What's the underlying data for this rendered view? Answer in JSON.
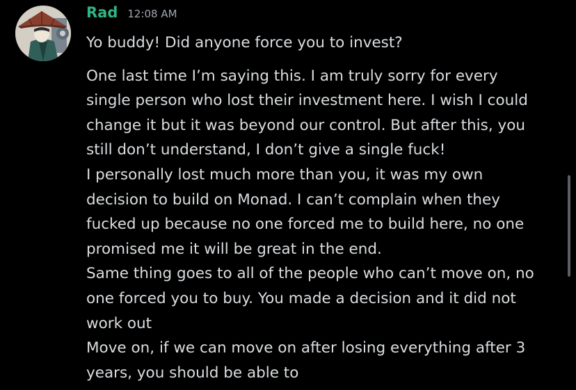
{
  "message": {
    "username": "Rad",
    "username_color": "#2fb584",
    "timestamp": "12:08 AM",
    "avatar": "avatar-icon",
    "lines": [
      "Yo buddy! Did anyone force you to invest?",
      "One last time I’m saying this. I am truly sorry for every",
      "single person who lost their investment here. I wish I could",
      "change it but it was beyond our control. But after this, you",
      "still don’t understand, I don’t give a single fuck!",
      "I personally lost much more than you, it was my own",
      "decision to build on Monad. I can’t complain when they",
      "fucked up because no one forced me to build here, no one",
      "promised me it will be great in the end.",
      "Same thing goes to all of the people who can’t move on, no",
      "one forced you to buy. You made a decision and it did not",
      "work out",
      "Move on, if we can move on after losing everything after 3",
      "years, you should be able to"
    ]
  },
  "colors": {
    "background": "#000000",
    "text": "#dbdee1",
    "timestamp": "#a2a7b0",
    "scrollbar": "#5b5e66"
  }
}
